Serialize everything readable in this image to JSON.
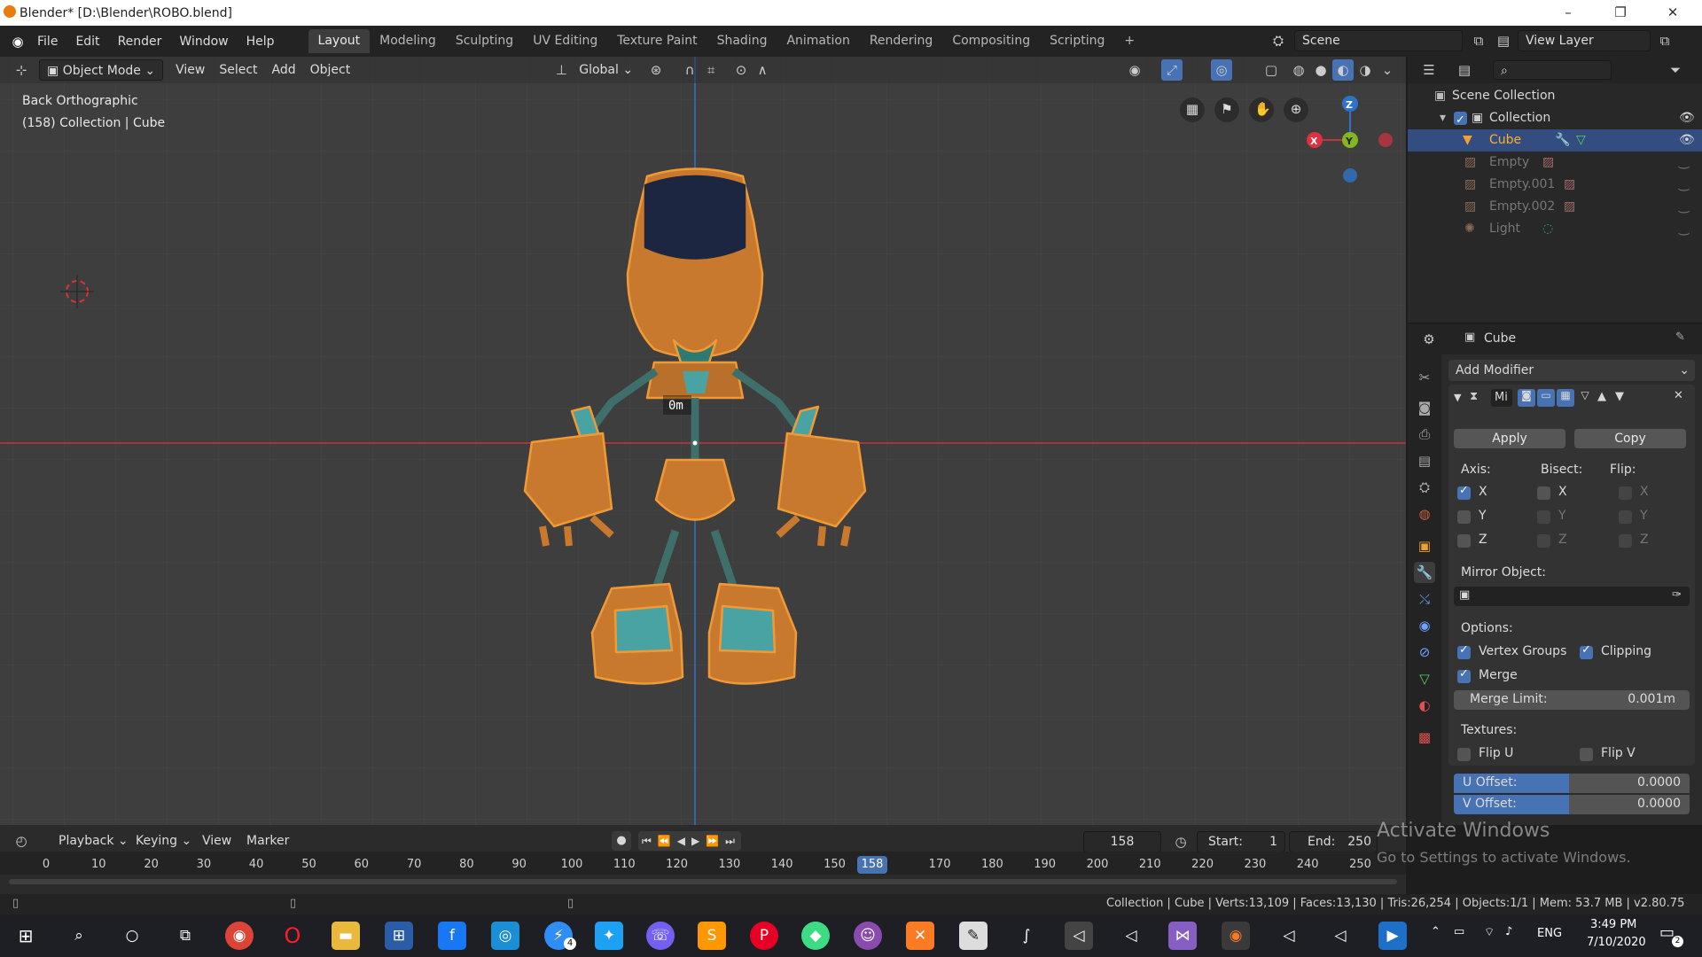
{
  "title_bar": {
    "title": "Blender* [D:\\Blender\\ROBO.blend]",
    "minimize": "–",
    "restore": "❐",
    "close": "✕"
  },
  "top_menu": [
    "File",
    "Edit",
    "Render",
    "Window",
    "Help"
  ],
  "workspace_tabs": [
    "Layout",
    "Modeling",
    "Sculpting",
    "UV Editing",
    "Texture Paint",
    "Shading",
    "Animation",
    "Rendering",
    "Compositing",
    "Scripting"
  ],
  "add_tab": "+",
  "scene": {
    "name": "Scene",
    "view_layer": "View Layer"
  },
  "viewport": {
    "mode": "Object Mode",
    "menus": [
      "View",
      "Select",
      "Add",
      "Object"
    ],
    "transform_orientation": "Global",
    "view_name": "Back Orthographic",
    "view_info": "(158) Collection | Cube",
    "measure_label": "0m",
    "gizmo": {
      "x": "X",
      "y": "Y",
      "z": "Z"
    },
    "colors": {
      "bg": "#3e3e3e",
      "x_axis": "#c0343f",
      "z_axis": "#2f73c9",
      "robot_orange": "#c9792e",
      "robot_teal": "#4aa3a3",
      "visor": "#1c2640"
    }
  },
  "outliner": {
    "root": "Scene Collection",
    "collection": "Collection",
    "items": [
      {
        "name": "Cube",
        "active": true
      },
      {
        "name": "Empty",
        "active": false
      },
      {
        "name": "Empty.001",
        "active": false
      },
      {
        "name": "Empty.002",
        "active": false
      },
      {
        "name": "Light",
        "active": false
      }
    ]
  },
  "properties": {
    "object_name": "Cube",
    "add_modifier": "Add Modifier",
    "modifier_name": "Mi",
    "apply": "Apply",
    "copy": "Copy",
    "axis_label": "Axis:",
    "bisect_label": "Bisect:",
    "flip_label": "Flip:",
    "x": "X",
    "y": "Y",
    "z": "Z",
    "mirror_object_label": "Mirror Object:",
    "options_label": "Options:",
    "vertex_groups": "Vertex Groups",
    "clipping": "Clipping",
    "merge": "Merge",
    "merge_limit_label": "Merge Limit:",
    "merge_limit_value": "0.001m",
    "textures_label": "Textures:",
    "flip_u": "Flip U",
    "flip_v": "Flip V",
    "u_offset_label": "U Offset:",
    "u_offset_value": "0.0000",
    "v_offset_label": "V Offset:",
    "v_offset_value": "0.0000"
  },
  "timeline": {
    "menus": [
      "Playback",
      "Keying",
      "View",
      "Marker"
    ],
    "current_frame": "158",
    "start_label": "Start:",
    "start_value": "1",
    "end_label": "End:",
    "end_value": "250",
    "ticks": [
      "0",
      "10",
      "20",
      "30",
      "40",
      "50",
      "60",
      "70",
      "80",
      "90",
      "100",
      "110",
      "120",
      "130",
      "140",
      "150",
      "158",
      "170",
      "180",
      "190",
      "200",
      "210",
      "220",
      "230",
      "240",
      "250"
    ]
  },
  "status_bar": {
    "text": "Collection | Cube | Verts:13,109 | Faces:13,130 | Tris:26,254 | Objects:1/1 | Mem: 53.7 MB | v2.80.75"
  },
  "watermark": {
    "line1": "Activate Windows",
    "line2": "Go to Settings to activate Windows."
  },
  "taskbar": {
    "lang": "ENG",
    "time": "3:49 PM",
    "date": "7/10/2020",
    "badge": "4",
    "notification_badge": "2"
  }
}
